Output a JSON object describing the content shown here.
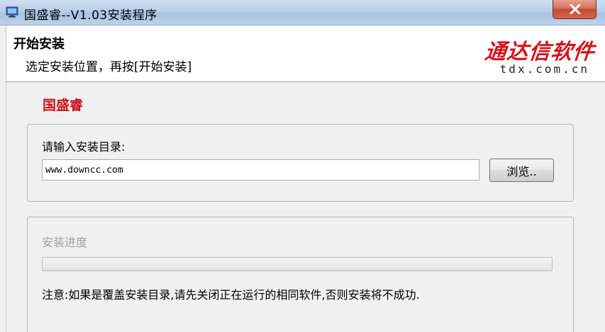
{
  "window": {
    "title": "国盛睿--V1.03安装程序"
  },
  "header": {
    "title": "开始安装",
    "subtitle": "选定安装位置，再按[开始安装]",
    "brand_cn": "通达信软件",
    "brand_en": "tdx.com.cn"
  },
  "app_name": "国盛睿",
  "install_dir": {
    "label": "请输入安装目录:",
    "value": "www.downcc.com",
    "browse_label": "浏览.."
  },
  "progress": {
    "label": "安装进度",
    "percent": 0,
    "notice": "注意:如果是覆盖安装目录,请先关闭正在运行的相同软件,否则安装将不成功."
  },
  "colors": {
    "brand_red": "#d7121a",
    "app_name_red": "#c8141b",
    "close_red": "#c44a33"
  },
  "icons": {
    "app": "monitor-icon",
    "close": "close-icon"
  }
}
